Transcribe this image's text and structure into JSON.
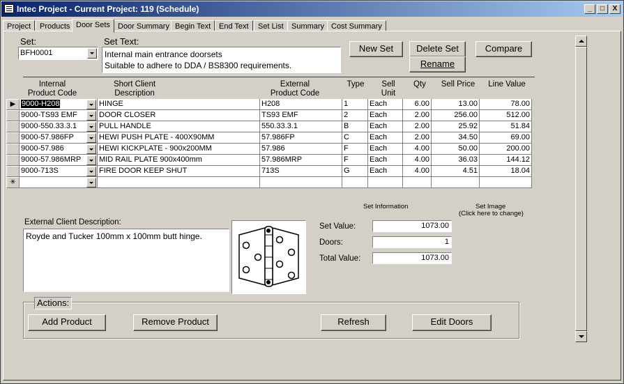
{
  "window": {
    "title": "Intec Project - Current Project: 119 (Schedule)",
    "minimize_glyph": "_",
    "maximize_glyph": "□",
    "close_glyph": "X"
  },
  "tabs": [
    {
      "label": "Project"
    },
    {
      "label": "Products"
    },
    {
      "label": "Door Sets",
      "active": true
    },
    {
      "label": "Door Summary"
    },
    {
      "label": "Begin Text"
    },
    {
      "label": "End Text"
    },
    {
      "label": "Set List"
    },
    {
      "label": "Summary"
    },
    {
      "label": "Cost Summary"
    }
  ],
  "set": {
    "label": "Set:",
    "value": "BFH0001",
    "text_label": "Set Text:",
    "text_line1": "Internal main entrance doorsets",
    "text_line2": "Suitable to adhere to DDA / BS8300 requirements."
  },
  "buttons": {
    "new_set": "New Set",
    "delete_set": "Delete Set",
    "compare": "Compare",
    "rename": "Rename",
    "add_product": "Add Product",
    "remove_product": "Remove Product",
    "refresh": "Refresh",
    "edit_doors": "Edit Doors"
  },
  "grid": {
    "headers": {
      "internal_code": "Internal\nProduct Code",
      "short_desc": "Short Client\nDescription",
      "external_code": "External\nProduct Code",
      "type": "Type",
      "sell_unit": "Sell\nUnit",
      "qty": "Qty",
      "sell_price": "Sell Price",
      "line_value": "Line Value"
    },
    "rows": [
      {
        "code": "9000-H208",
        "desc": "HINGE",
        "ext": "H208",
        "type": "1",
        "unit": "Each",
        "qty": "6.00",
        "price": "13.00",
        "value": "78.00"
      },
      {
        "code": "9000-TS93 EMF",
        "desc": "DOOR CLOSER",
        "ext": "TS93 EMF",
        "type": "2",
        "unit": "Each",
        "qty": "2.00",
        "price": "256.00",
        "value": "512.00"
      },
      {
        "code": "9000-550.33.3.1",
        "desc": "PULL HANDLE",
        "ext": "550.33.3.1",
        "type": "B",
        "unit": "Each",
        "qty": "2.00",
        "price": "25.92",
        "value": "51.84"
      },
      {
        "code": "9000-57.986FP",
        "desc": "HEWI PUSH PLATE - 400X90MM",
        "ext": "57.986FP",
        "type": "C",
        "unit": "Each",
        "qty": "2.00",
        "price": "34.50",
        "value": "69.00"
      },
      {
        "code": "9000-57.986",
        "desc": "HEWI KICKPLATE - 900x200MM",
        "ext": "57.986",
        "type": "F",
        "unit": "Each",
        "qty": "4.00",
        "price": "50.00",
        "value": "200.00"
      },
      {
        "code": "9000-57.986MRP",
        "desc": "MID RAIL PLATE 900x400mm",
        "ext": "57.986MRP",
        "type": "F",
        "unit": "Each",
        "qty": "4.00",
        "price": "36.03",
        "value": "144.12"
      },
      {
        "code": "9000-713S",
        "desc": "FIRE DOOR KEEP SHUT",
        "ext": "713S",
        "type": "G",
        "unit": "Each",
        "qty": "4.00",
        "price": "4.51",
        "value": "18.04"
      }
    ],
    "current_row_glyph": "▶",
    "new_row_glyph": "✳"
  },
  "external_desc": {
    "label": "External Client Description:",
    "value": "Royde and Tucker 100mm x 100mm butt hinge."
  },
  "set_info": {
    "heading": "Set Information",
    "image_heading_line1": "Set Image",
    "image_heading_line2": "(Click here to change)",
    "set_value_label": "Set Value:",
    "set_value": "1073.00",
    "doors_label": "Doors:",
    "doors": "1",
    "total_value_label": "Total Value:",
    "total_value": "1073.00"
  },
  "actions": {
    "label": "Actions:"
  }
}
